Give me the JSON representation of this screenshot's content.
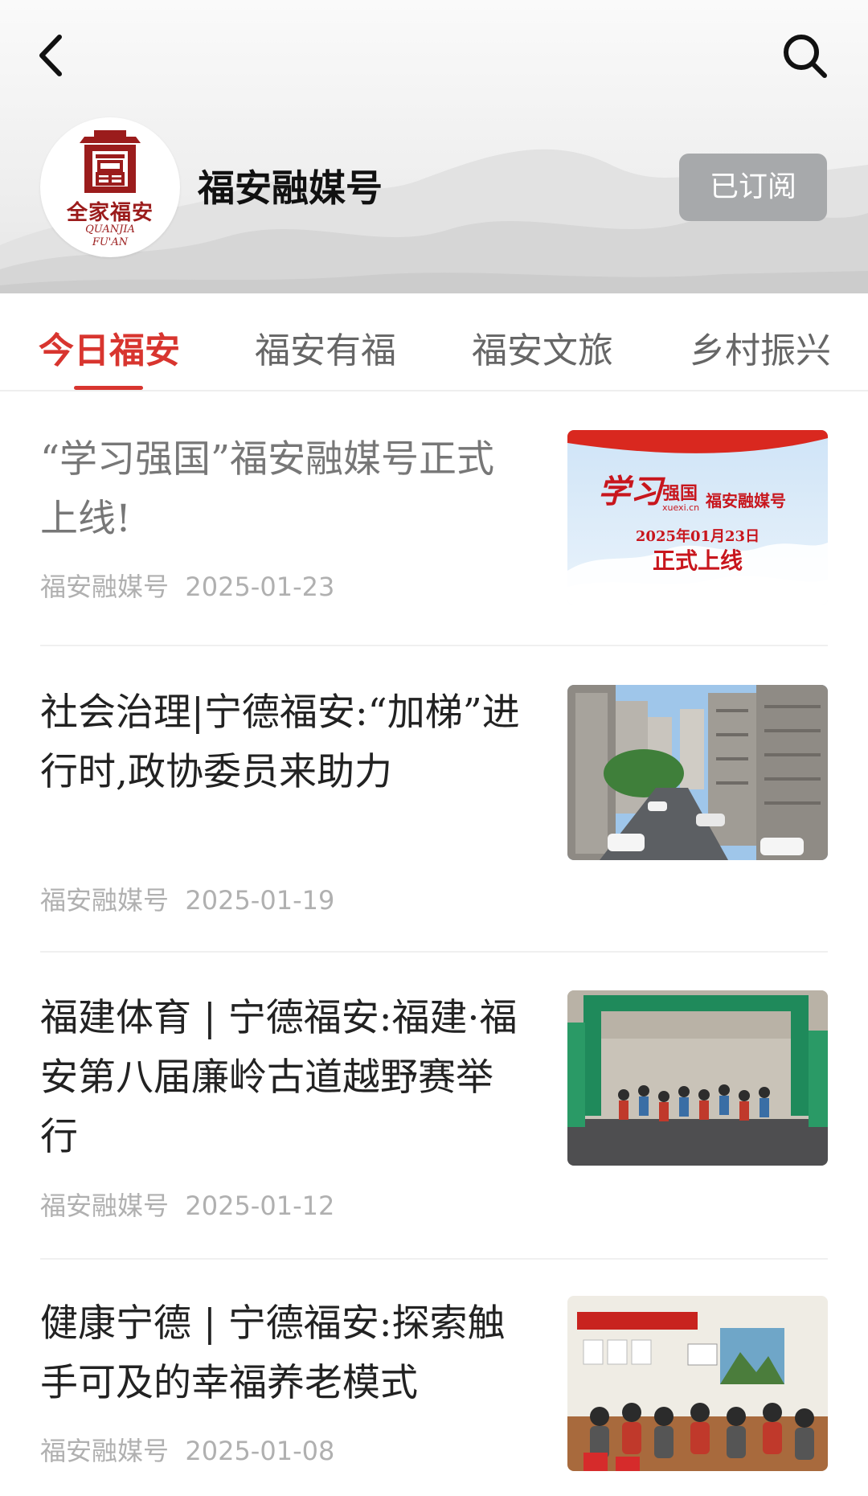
{
  "channel": {
    "name": "福安融媒号",
    "subscribe_label": "已订阅"
  },
  "logo": {
    "text": "全家福安",
    "sub1": "QUANJIA",
    "sub2": "FU'AN"
  },
  "tabs": [
    {
      "label": "今日福安",
      "active": true
    },
    {
      "label": "福安有福",
      "active": false
    },
    {
      "label": "福安文旅",
      "active": false
    },
    {
      "label": "乡村振兴",
      "active": false
    }
  ],
  "articles": [
    {
      "title": "“学习强国”福安融媒号正式上线!",
      "source": "福安融媒号",
      "date": "2025-01-23",
      "thumb": {
        "brand": "学习",
        "brand2": "强国",
        "site": "xuexi.cn",
        "channel": "福安融媒号",
        "date": "2025年01月23日",
        "headline": "正式上线"
      }
    },
    {
      "title": "社会治理|宁德福安:“加梯”进行时,政协委员来助力",
      "source": "福安融媒号",
      "date": "2025-01-19"
    },
    {
      "title": "福建体育 | 宁德福安:福建·福安第八届廉岭古道越野赛举行",
      "source": "福安融媒号",
      "date": "2025-01-12"
    },
    {
      "title": "健康宁德 | 宁德福安:探索触手可及的幸福养老模式",
      "source": "福安融媒号",
      "date": "2025-01-08"
    }
  ],
  "colors": {
    "accent": "#d8352f",
    "subscribed_bg": "#a7a9ab",
    "logo": "#9b1c1c",
    "meta": "#b0b0b0"
  }
}
